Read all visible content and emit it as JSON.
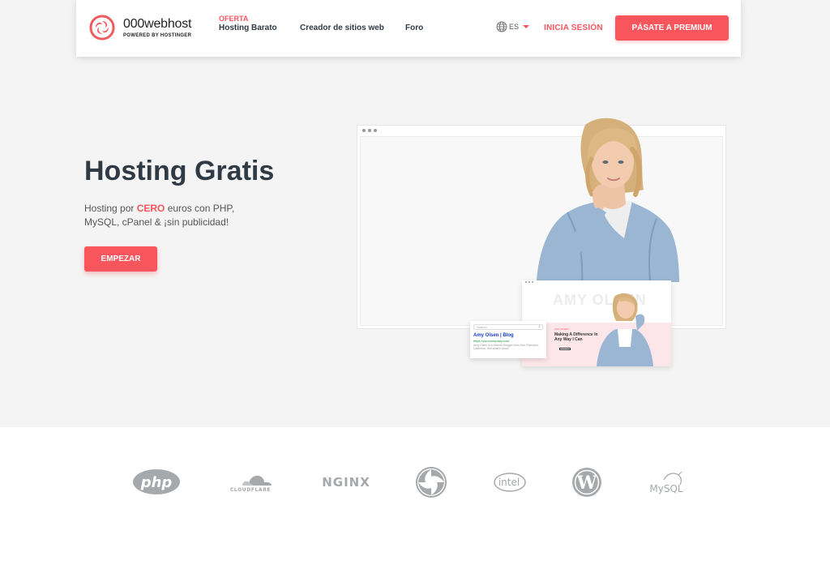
{
  "nav": {
    "logo_name": "000webhost",
    "logo_sub": "POWERED BY HOSTINGER",
    "oferta_label": "OFERTA",
    "hosting_label": "Hosting Barato",
    "creador_label": "Creador de sitios web",
    "foro_label": "Foro",
    "lang_label": "ES",
    "login_label": "INICIA SESIÓN",
    "premium_label": "PÁSATE A PREMIUM"
  },
  "hero": {
    "title": "Hosting Gratis",
    "sub_pre": "Hosting por ",
    "sub_highlight": "CERO",
    "sub_post": " euros con PHP, MySQL, cPanel & ¡sin publicidad!",
    "cta_label": "EMPEZAR"
  },
  "mockup": {
    "site_name": "AMY OLSEN",
    "site_kicker": "AMY OLSEN",
    "site_heading": "Making A Difference In Any Way I Can",
    "serp_search": "Search",
    "serp_title": "Amy Olsen | Blog",
    "serp_url": "https://yourcompany.com",
    "serp_desc": "Amy Olsen is a Natural Blogger from San Francisco, California. See what's about"
  },
  "tech_logos": [
    {
      "name": "php-logo",
      "text": "php"
    },
    {
      "name": "cloudflare-logo",
      "text": "CLOUDFLARE"
    },
    {
      "name": "nginx-logo",
      "text": "NGINX"
    },
    {
      "name": "000webhost-logo",
      "text": ""
    },
    {
      "name": "intel-logo",
      "text": "intel"
    },
    {
      "name": "wordpress-logo",
      "text": ""
    },
    {
      "name": "mysql-logo",
      "text": "MySQL"
    }
  ],
  "colors": {
    "accent": "#f9555c",
    "text": "#2f3a45",
    "hero_bg": "#f4f4f4",
    "logo_gray": "#a6a9ab"
  }
}
